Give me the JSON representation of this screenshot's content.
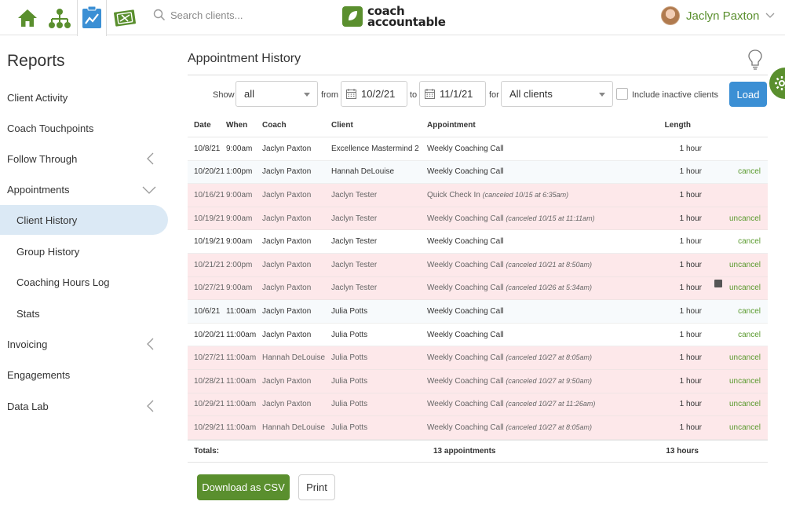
{
  "topbar": {
    "search_placeholder": "Search clients...",
    "logo_line1": "coach",
    "logo_line2": "accountable",
    "user_name": "Jaclyn Paxton",
    "accent": "#5a8f2e"
  },
  "sidebar": {
    "title": "Reports",
    "items": [
      {
        "label": "Client Activity"
      },
      {
        "label": "Coach Touchpoints"
      },
      {
        "label": "Follow Through"
      },
      {
        "label": "Appointments"
      },
      {
        "label": "Client History"
      },
      {
        "label": "Group History"
      },
      {
        "label": "Coaching Hours Log"
      },
      {
        "label": "Stats"
      },
      {
        "label": "Invoicing"
      },
      {
        "label": "Engagements"
      },
      {
        "label": "Data Lab"
      }
    ]
  },
  "main": {
    "title": "Appointment History",
    "filters": {
      "show_label": "Show",
      "show_value": "all",
      "from_label": "from",
      "from_date": "10/2/21",
      "to_label": "to",
      "to_date": "11/1/21",
      "for_label": "for",
      "client_value": "All clients",
      "inactive_label": "Include inactive clients",
      "load_label": "Load"
    },
    "columns": [
      "Date",
      "When",
      "Coach",
      "Client",
      "Appointment",
      "Length"
    ],
    "rows": [
      {
        "date": "10/8/21",
        "when": "9:00am",
        "coach": "Jaclyn Paxton",
        "client": "Excellence Mastermind 2",
        "appt": "Weekly Coaching Call",
        "note": "",
        "length": "1 hour",
        "action": ""
      },
      {
        "date": "10/20/21",
        "when": "1:00pm",
        "coach": "Jaclyn Paxton",
        "client": "Hannah DeLouise",
        "appt": "Weekly Coaching Call",
        "note": "",
        "length": "1 hour",
        "action": "cancel"
      },
      {
        "date": "10/16/21",
        "when": "9:00am",
        "coach": "Jaclyn Paxton",
        "client": "Jaclyn Tester",
        "appt": "Quick Check In",
        "note": "(canceled 10/15 at 6:35am)",
        "length": "1 hour",
        "action": ""
      },
      {
        "date": "10/19/21",
        "when": "9:00am",
        "coach": "Jaclyn Paxton",
        "client": "Jaclyn Tester",
        "appt": "Weekly Coaching Call",
        "note": "(canceled 10/15 at 11:11am)",
        "length": "1 hour",
        "action": "uncancel"
      },
      {
        "date": "10/19/21",
        "when": "9:00am",
        "coach": "Jaclyn Paxton",
        "client": "Jaclyn Tester",
        "appt": "Weekly Coaching Call",
        "note": "",
        "length": "1 hour",
        "action": "cancel"
      },
      {
        "date": "10/21/21",
        "when": "2:00pm",
        "coach": "Jaclyn Paxton",
        "client": "Jaclyn Tester",
        "appt": "Weekly Coaching Call",
        "note": "(canceled 10/21 at 8:50am)",
        "length": "1 hour",
        "action": "uncancel"
      },
      {
        "date": "10/27/21",
        "when": "9:00am",
        "coach": "Jaclyn Paxton",
        "client": "Jaclyn Tester",
        "appt": "Weekly Coaching Call",
        "note": "(canceled 10/26 at 5:34am)",
        "length": "1 hour",
        "action": "uncancel"
      },
      {
        "date": "10/6/21",
        "when": "11:00am",
        "coach": "Jaclyn Paxton",
        "client": "Julia Potts",
        "appt": "Weekly Coaching Call",
        "note": "",
        "length": "1 hour",
        "action": "cancel"
      },
      {
        "date": "10/20/21",
        "when": "11:00am",
        "coach": "Jaclyn Paxton",
        "client": "Julia Potts",
        "appt": "Weekly Coaching Call",
        "note": "",
        "length": "1 hour",
        "action": "cancel"
      },
      {
        "date": "10/27/21",
        "when": "11:00am",
        "coach": "Hannah DeLouise",
        "client": "Julia Potts",
        "appt": "Weekly Coaching Call",
        "note": "(canceled 10/27 at 8:05am)",
        "length": "1 hour",
        "action": "uncancel"
      },
      {
        "date": "10/28/21",
        "when": "11:00am",
        "coach": "Jaclyn Paxton",
        "client": "Julia Potts",
        "appt": "Weekly Coaching Call",
        "note": "(canceled 10/27 at 9:50am)",
        "length": "1 hour",
        "action": "uncancel"
      },
      {
        "date": "10/29/21",
        "when": "11:00am",
        "coach": "Jaclyn Paxton",
        "client": "Julia Potts",
        "appt": "Weekly Coaching Call",
        "note": "(canceled 10/27 at 11:26am)",
        "length": "1 hour",
        "action": "uncancel"
      },
      {
        "date": "10/29/21",
        "when": "11:00am",
        "coach": "Hannah DeLouise",
        "client": "Julia Potts",
        "appt": "Weekly Coaching Call",
        "note": "(canceled 10/27 at 8:05am)",
        "length": "1 hour",
        "action": "uncancel"
      }
    ],
    "totals": {
      "label": "Totals:",
      "appointments": "13 appointments",
      "hours": "13 hours"
    },
    "buttons": {
      "csv": "Download as CSV",
      "print": "Print"
    }
  }
}
